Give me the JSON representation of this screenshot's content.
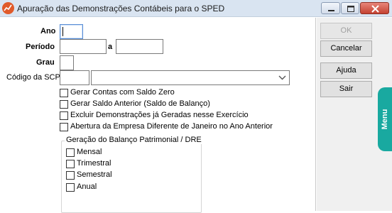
{
  "window": {
    "title": "Apuração das Demonstrações Contábeis para o SPED",
    "app_icon": "chart-icon",
    "controls": [
      "minimize-icon",
      "maximize-icon",
      "close-icon"
    ]
  },
  "form": {
    "ano": {
      "label": "Ano",
      "value": ""
    },
    "periodo": {
      "label": "Período",
      "value_from": "",
      "separator": "a",
      "value_to": ""
    },
    "grau": {
      "label": "Grau",
      "value": ""
    },
    "codigo_scp": {
      "label": "Código da SCP",
      "code_value": "",
      "description_value": ""
    },
    "checkboxes": [
      {
        "label": "Gerar Contas com Saldo Zero",
        "checked": false
      },
      {
        "label": "Gerar Saldo Anterior (Saldo de Balanço)",
        "checked": false
      },
      {
        "label": "Excluir Demonstrações já Geradas nesse Exercício",
        "checked": false
      },
      {
        "label": "Abertura da Empresa Diferente de Janeiro no Ano Anterior",
        "checked": false
      }
    ],
    "geracao_group": {
      "title": "Geração do Balanço Patrimonial / DRE",
      "options": [
        {
          "label": "Mensal",
          "checked": false
        },
        {
          "label": "Trimestral",
          "checked": false
        },
        {
          "label": "Semestral",
          "checked": false
        },
        {
          "label": "Anual",
          "checked": false
        }
      ]
    }
  },
  "buttons": {
    "ok": "OK",
    "cancelar": "Cancelar",
    "ajuda": "Ajuda",
    "sair": "Sair"
  },
  "side_tab": {
    "label": "Menu"
  },
  "colors": {
    "titlebar": "#d9e4f1",
    "close_button": "#c44232",
    "menu_tab": "#19a9a0"
  }
}
